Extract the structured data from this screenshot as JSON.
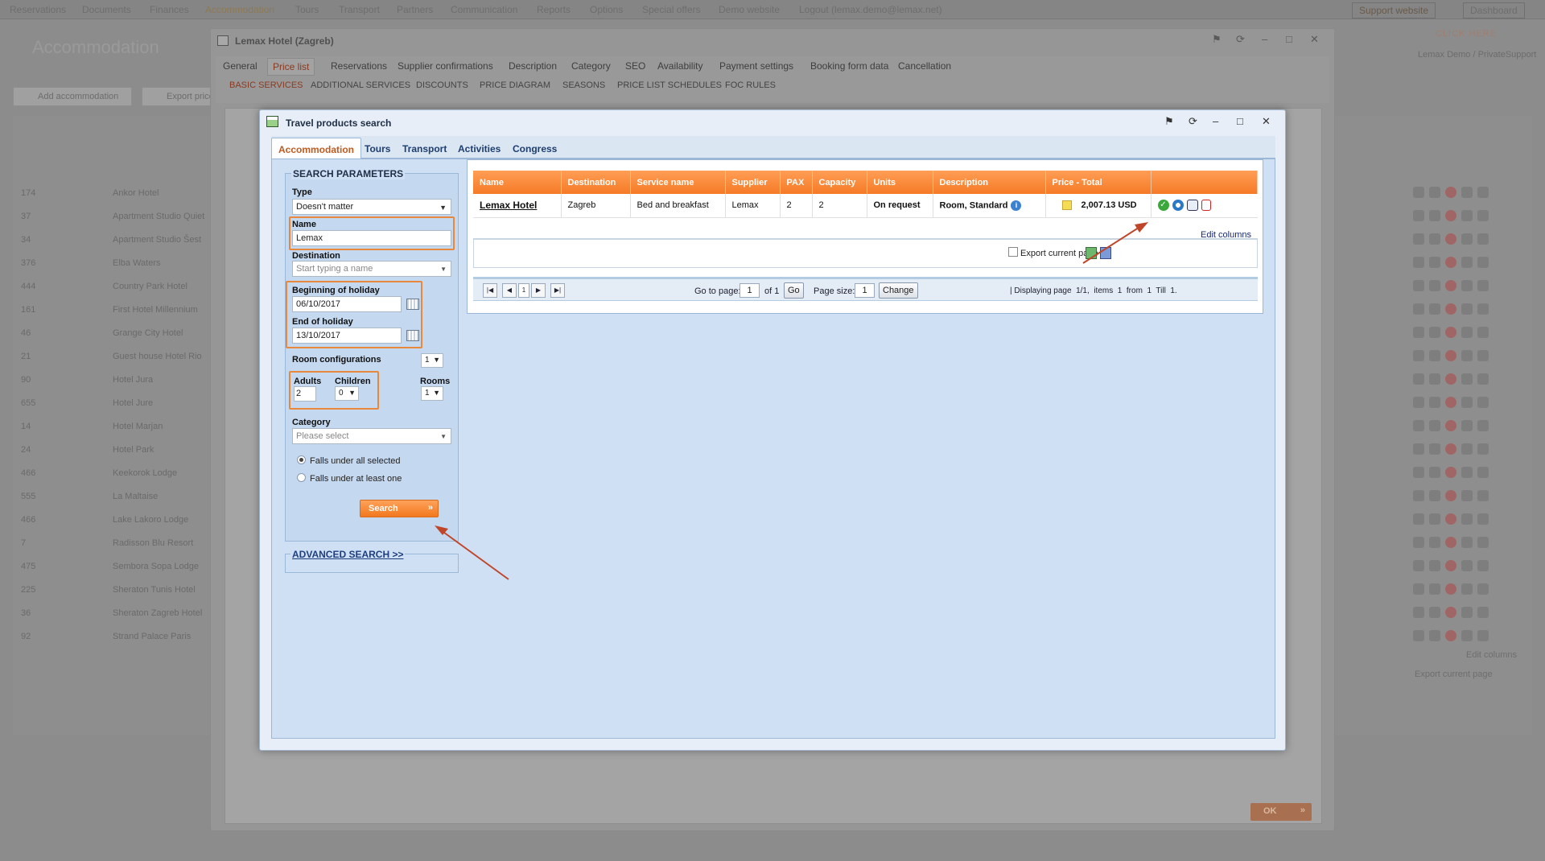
{
  "background": {
    "nav": [
      "Reservations",
      "Documents",
      "Finances",
      "Accommodation",
      "Tours",
      "Transport",
      "Partners",
      "Communication",
      "Reports",
      "Options",
      "Special offers",
      "Demo website",
      "Logout (lemax.demo@lemax.net)"
    ],
    "support": "Support website",
    "dashboard": "Dashboard",
    "page_title": "Accommodation",
    "click_here": "CLICK HERE",
    "admin_label": "Lemax Demo / PrivateSupport",
    "add_button": "Add accommodation",
    "export_button": "Export price",
    "rows": [
      {
        "id": "174",
        "name": "Ankor Hotel"
      },
      {
        "id": "37",
        "name": "Apartment Studio Quiet"
      },
      {
        "id": "34",
        "name": "Apartment Studio Šest"
      },
      {
        "id": "376",
        "name": "Elba Waters"
      },
      {
        "id": "444",
        "name": "Country Park Hotel"
      },
      {
        "id": "161",
        "name": "First Hotel Millennium"
      },
      {
        "id": "46",
        "name": "Grange City Hotel"
      },
      {
        "id": "21",
        "name": "Guest house Hotel Rio"
      },
      {
        "id": "90",
        "name": "Hotel Jura"
      },
      {
        "id": "655",
        "name": "Hotel Jure"
      },
      {
        "id": "14",
        "name": "Hotel Marjan"
      },
      {
        "id": "24",
        "name": "Hotel Park"
      },
      {
        "id": "466",
        "name": "Keekorok Lodge"
      },
      {
        "id": "555",
        "name": "La Maltaise"
      },
      {
        "id": "466",
        "name": "Lake Lakoro Lodge"
      },
      {
        "id": "7",
        "name": "Radisson Blu Resort"
      },
      {
        "id": "475",
        "name": "Sembora Sopa Lodge"
      },
      {
        "id": "225",
        "name": "Sheraton Tunis Hotel"
      },
      {
        "id": "36",
        "name": "Sheraton Zagreb Hotel"
      },
      {
        "id": "92",
        "name": "Strand Palace Paris"
      }
    ],
    "edit_columns": "Edit columns",
    "export_current": "Export current page"
  },
  "hotel_window": {
    "title": "Lemax Hotel (Zagreb)",
    "tabs": [
      "General",
      "Price list",
      "Reservations",
      "Supplier confirmations",
      "Description",
      "Category",
      "SEO",
      "Availability",
      "Payment settings",
      "Booking form data",
      "Cancellation"
    ],
    "active_tab": "Price list",
    "subtabs": [
      "BASIC SERVICES",
      "ADDITIONAL SERVICES",
      "DISCOUNTS",
      "PRICE DIAGRAM",
      "SEASONS",
      "PRICE LIST SCHEDULES",
      "FOC RULES"
    ],
    "ok": "OK"
  },
  "search_window": {
    "title": "Travel products search",
    "tabs": [
      "Accommodation",
      "Tours",
      "Transport",
      "Activities",
      "Congress"
    ],
    "active_tab": "Accommodation",
    "params": {
      "legend": "SEARCH PARAMETERS",
      "type_label": "Type",
      "type_value": "Doesn't matter",
      "name_label": "Name",
      "name_value": "Lemax",
      "destination_label": "Destination",
      "destination_placeholder": "Start typing a name",
      "begin_label": "Beginning of holiday",
      "begin_value": "06/10/2017",
      "end_label": "End of holiday",
      "end_value": "13/10/2017",
      "room_config_label": "Room configurations",
      "room_config_value": "1",
      "adults_label": "Adults",
      "adults_value": "2",
      "children_label": "Children",
      "children_value": "0",
      "rooms_label": "Rooms",
      "rooms_value": "1",
      "category_label": "Category",
      "category_placeholder": "Please select",
      "radio_all": "Falls under all selected",
      "radio_one": "Falls under at least one",
      "search_button": "Search",
      "advanced": "ADVANCED SEARCH >>"
    },
    "results": {
      "columns": [
        "Name",
        "Destination",
        "Service name",
        "Supplier",
        "PAX",
        "Capacity",
        "Units",
        "Description",
        "Price - Total",
        ""
      ],
      "rows": [
        {
          "name": "Lemax Hotel",
          "destination": "Zagreb",
          "service": "Bed and breakfast",
          "supplier": "Lemax",
          "pax": "2",
          "capacity": "2",
          "units": "On request",
          "description": "Room, Standard",
          "price": "2,007.13 USD"
        }
      ],
      "edit_columns": "Edit columns",
      "export_current": "Export current page"
    },
    "pager": {
      "page": "1",
      "goto_label": "Go to page:",
      "goto_value": "1",
      "of_label": "of 1",
      "go": "Go",
      "pagesize_label": "Page size:",
      "pagesize_value": "1",
      "change": "Change",
      "status": "| Displaying page  1/1,  items  1  from  1  Till  1."
    }
  },
  "colors": {
    "accent_orange": "#f57a26",
    "highlight_box": "#e8883c",
    "annotation_arrow": "#c0462a",
    "tab_active_text": "#c05a1e"
  }
}
